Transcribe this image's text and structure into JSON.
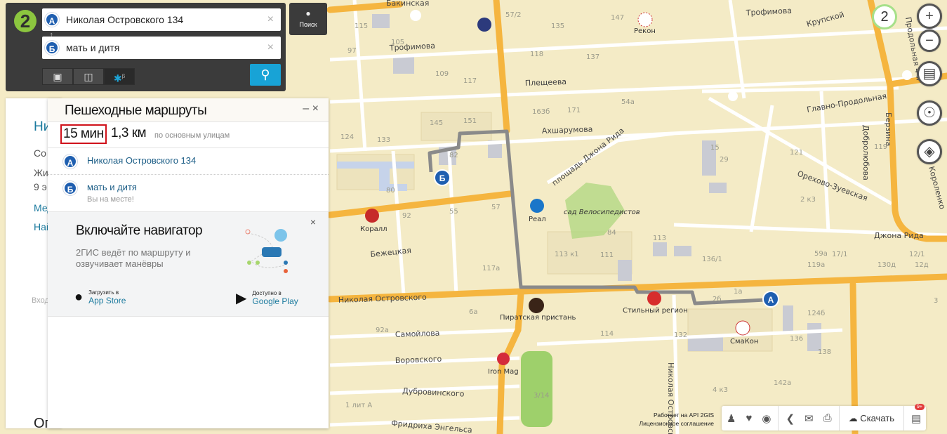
{
  "search": {
    "logo": "2",
    "point_a": {
      "badge": "А",
      "value": "Николая Островского 134"
    },
    "point_b": {
      "badge": "Б",
      "value": "мать и дитя"
    },
    "clear_icon": "×",
    "swap_icon": "↕",
    "modes": [
      {
        "name": "car",
        "icon": "car-icon",
        "glyph": "🚘"
      },
      {
        "name": "bus",
        "icon": "bus-icon",
        "glyph": "🚌"
      },
      {
        "name": "walk",
        "icon": "pedestrian-icon",
        "glyph": "🚶",
        "beta": "β",
        "active": true
      }
    ],
    "go_icon": "search-icon",
    "search_tab_label": "Поиск"
  },
  "sidebar_partial": [
    "Ни",
    "Со",
    "Жи",
    "9 э",
    "Мед",
    "Най",
    "Вход",
    "Ог"
  ],
  "route": {
    "title": "Пешеходные маршруты",
    "minimize": "–",
    "close": "×",
    "time": "15 мин",
    "distance": "1,3 км",
    "via": "по основным улицам",
    "start": {
      "badge": "А",
      "name": "Николая Островского 134"
    },
    "end": {
      "badge": "Б",
      "name": "мать и дитя",
      "note": "Вы на месте!"
    },
    "highlight_color": "#d0121b"
  },
  "promo": {
    "title": "Включайте навигатор",
    "description": "2ГИС ведёт по маршруту и озвучивает манёвры",
    "close": "×",
    "app_store": {
      "small": "Загрузить в",
      "big": "App Store"
    },
    "google_play": {
      "small": "Доступно в",
      "big": "Google Play"
    }
  },
  "map": {
    "zoom_level": "2",
    "controls": {
      "zoom_in": "+",
      "zoom_out": "−"
    },
    "colors": {
      "background": "#f4ebc6",
      "main_road": "#f5b53f",
      "route": "#8a8a8a",
      "badge": "#1f5fb0"
    },
    "streets": [
      "Бакинская",
      "Трофимова",
      "Плещеева",
      "Ахшарумова",
      "площадь Джона Рида",
      "Главно-Продольная",
      "Орехово-Зуевская",
      "Добролюбова",
      "Берзина",
      "Короленко",
      "Джона Рида",
      "Бежецкая",
      "Николая Островского",
      "Самойлова",
      "Воровского",
      "Дубровинского",
      "Фридриха Энгельса",
      "Николая Островского",
      "Крупской",
      "Трофимова",
      "Продольная 4-я"
    ],
    "places": [
      "Рекон",
      "Реал",
      "сад Велосипедистов",
      "Коралл",
      "Пиратская пристань",
      "Стильный регион",
      "СмаКон",
      "Iron Mag"
    ],
    "house_numbers": [
      "115",
      "105",
      "97",
      "109",
      "117",
      "57/2",
      "135",
      "147",
      "118",
      "137",
      "163б",
      "171",
      "54а",
      "145",
      "151",
      "133",
      "124",
      "82",
      "80",
      "92",
      "55",
      "57",
      "84",
      "113 к1",
      "111",
      "113",
      "117а",
      "6а",
      "92а",
      "114",
      "2б",
      "124б",
      "132",
      "136/1",
      "130д",
      "119",
      "121",
      "29",
      "15",
      "2 к3",
      "1а",
      "3",
      "138",
      "142а",
      "136",
      "3/14",
      "4 к3",
      "1 лит А",
      "17/1",
      "59а",
      "12/1",
      "119а",
      "12д"
    ]
  },
  "footer": {
    "api": "Работает на API 2GIS",
    "license": "Лицензионное соглашение",
    "download": "Скачать",
    "notifications": "9+"
  }
}
